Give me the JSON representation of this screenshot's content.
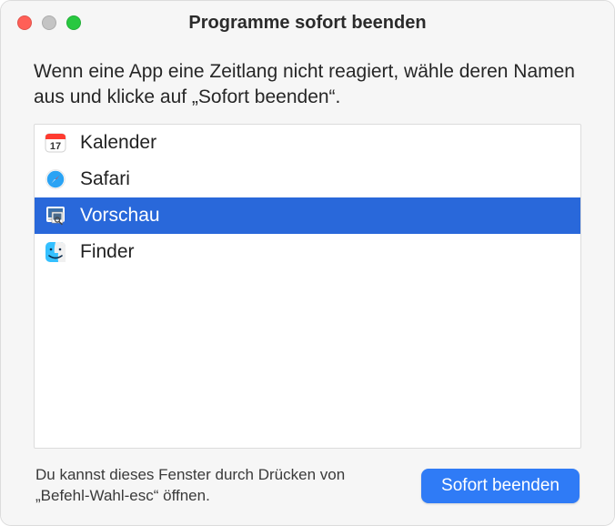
{
  "window": {
    "title": "Programme sofort beenden"
  },
  "instructions": "Wenn eine App eine Zeitlang nicht reagiert, wähle deren Namen aus und klicke auf „Sofort beenden“.",
  "apps": [
    {
      "name": "Kalender",
      "icon": "calendar",
      "selected": false
    },
    {
      "name": "Safari",
      "icon": "safari",
      "selected": false
    },
    {
      "name": "Vorschau",
      "icon": "preview",
      "selected": true
    },
    {
      "name": "Finder",
      "icon": "finder",
      "selected": false
    }
  ],
  "footer": {
    "hint": "Du kannst dieses Fenster durch Drücken von „Befehl-Wahl-esc“ öffnen.",
    "button_label": "Sofort beenden"
  }
}
